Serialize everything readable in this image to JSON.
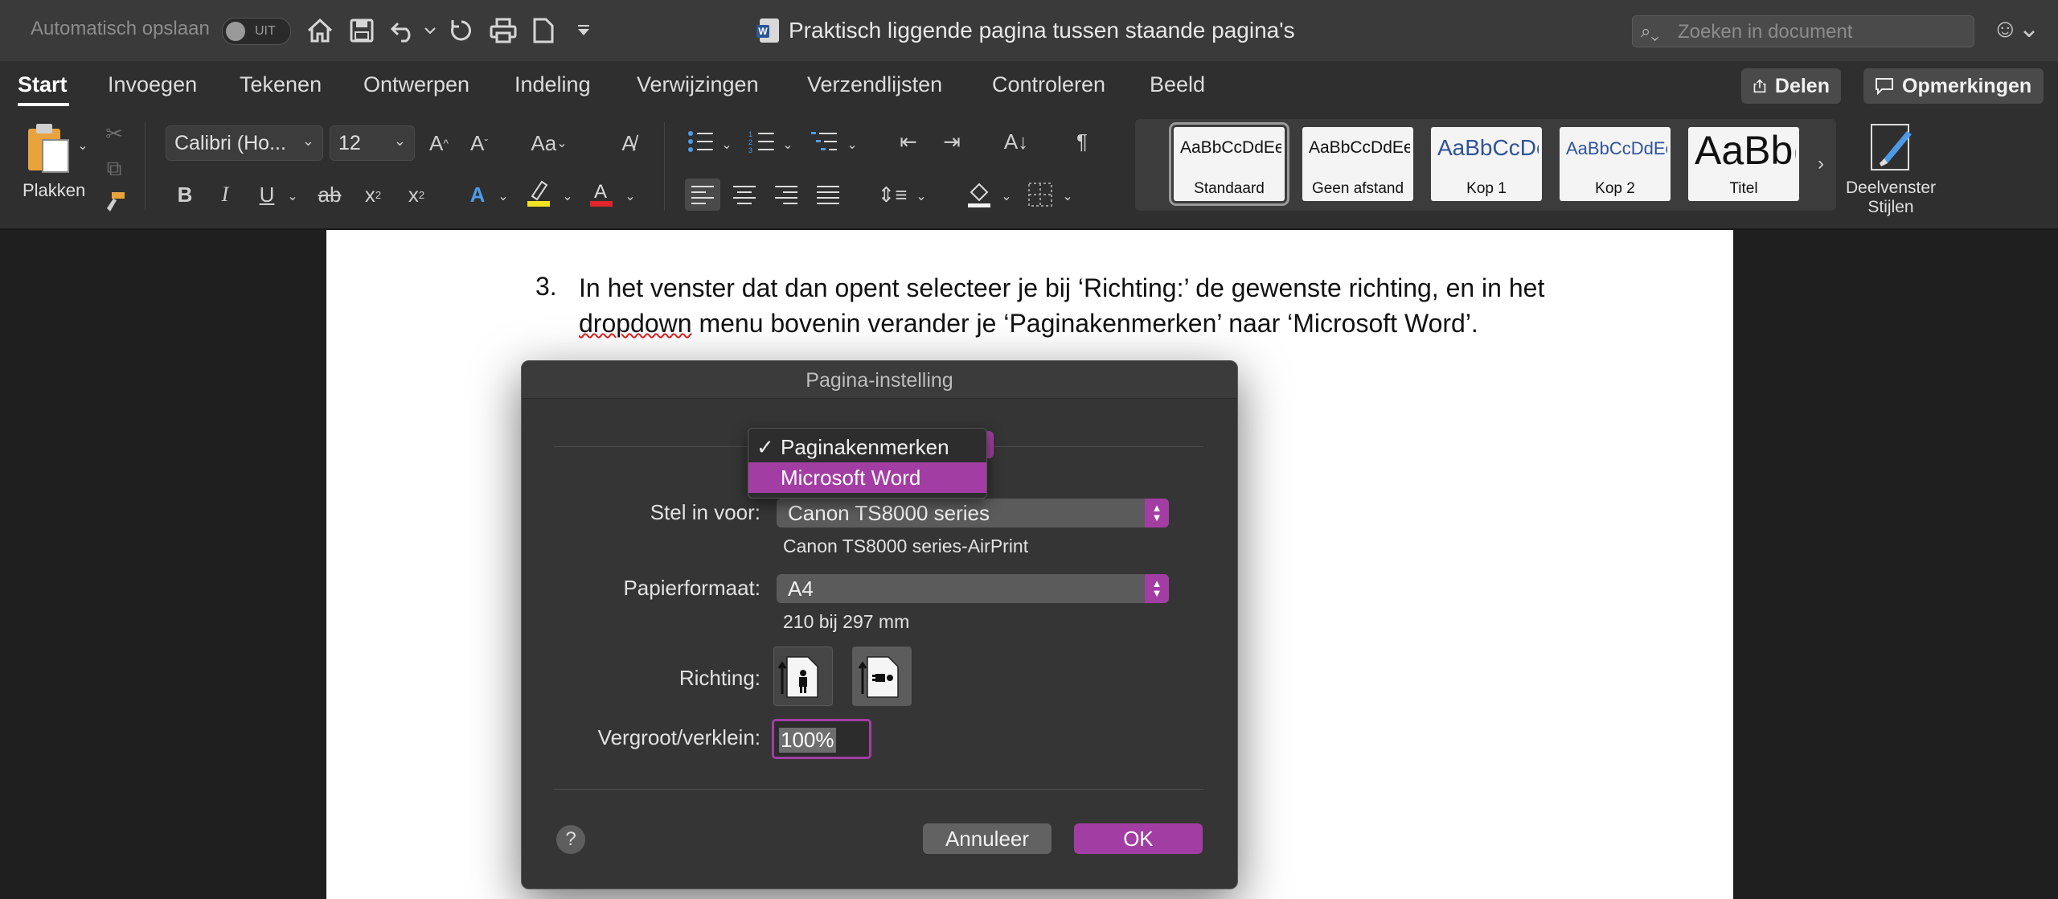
{
  "titlebar": {
    "autosave_label": "Automatisch opslaan",
    "autosave_state": "UIT",
    "doc_title": "Praktisch liggende pagina tussen staande pagina's",
    "search_placeholder": "Zoeken in document"
  },
  "tabs": [
    "Start",
    "Invoegen",
    "Tekenen",
    "Ontwerpen",
    "Indeling",
    "Verwijzingen",
    "Verzendlijsten",
    "Controleren",
    "Beeld"
  ],
  "actions": {
    "share": "Delen",
    "comments": "Opmerkingen"
  },
  "ribbon": {
    "paste_label": "Plakken",
    "font_name": "Calibri (Ho...",
    "font_size": "12",
    "styles": [
      {
        "sample": "AaBbCcDdEe",
        "label": "Standaard"
      },
      {
        "sample": "AaBbCcDdEe",
        "label": "Geen afstand"
      },
      {
        "sample": "AaBbCcDc",
        "label": "Kop 1"
      },
      {
        "sample": "AaBbCcDdEe",
        "label": "Kop 2"
      },
      {
        "sample": "AaBb(",
        "label": "Titel"
      }
    ],
    "styles_pane_label_1": "Deelvenster",
    "styles_pane_label_2": "Stijlen"
  },
  "document": {
    "list_number": "3.",
    "line1": "In het venster dat dan opent selecteer je bij ‘Richting:’ de gewenste richting, en in het",
    "line2_word": "dropdown",
    "line2_rest": " menu bovenin verander je ‘Paginakenmerken’ naar ‘Microsoft Word’."
  },
  "dialog": {
    "title": "Pagina-instelling",
    "menu_items": [
      "Paginakenmerken",
      "Microsoft Word"
    ],
    "menu_checked": "Paginakenmerken",
    "menu_highlighted": "Microsoft Word",
    "format_for_label": "Stel in voor:",
    "format_for_value": "Canon TS8000 series",
    "format_for_sub": "Canon TS8000 series-AirPrint",
    "paper_size_label": "Papierformaat:",
    "paper_size_value": "A4",
    "paper_size_sub": "210 bij 297 mm",
    "orientation_label": "Richting:",
    "scale_label": "Vergroot/verklein:",
    "scale_value": "100%",
    "cancel": "Annuleer",
    "ok": "OK",
    "help": "?"
  },
  "colors": {
    "accent": "#a23ea3",
    "ribbon_bg": "#2f2f2f",
    "titlebar_bg": "#3a3a3a"
  }
}
